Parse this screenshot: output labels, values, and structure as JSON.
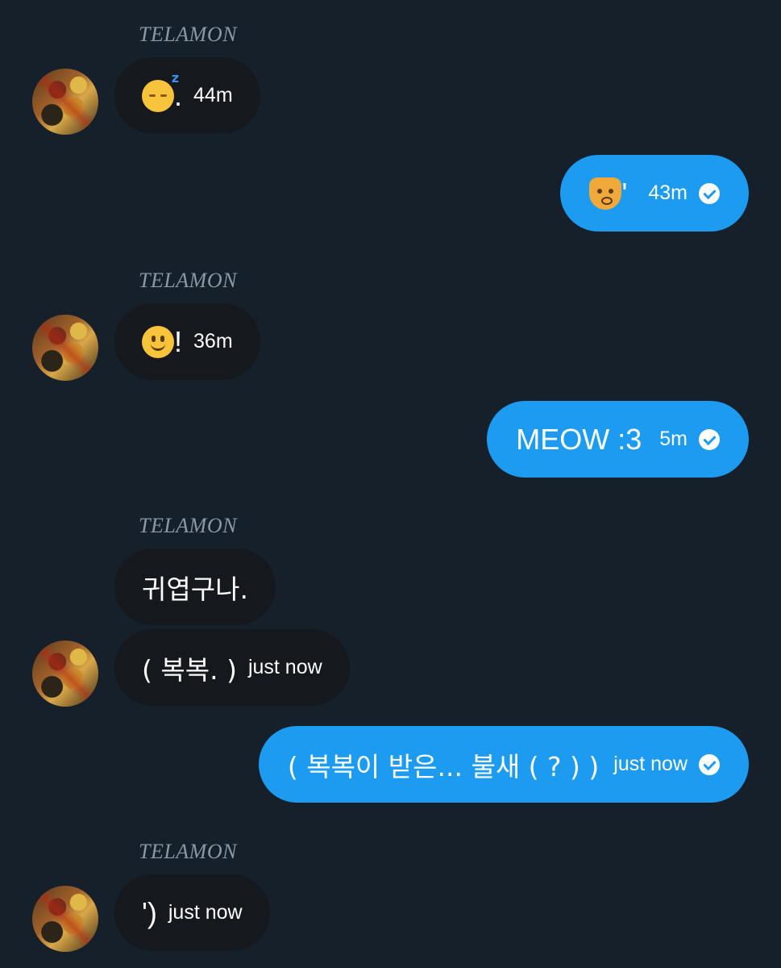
{
  "sender_name": "TELAMON",
  "messages": [
    {
      "id": "m1",
      "side": "in",
      "icon": "sleeping-face-emoji",
      "text": ".",
      "time": "44m"
    },
    {
      "id": "m2",
      "side": "out",
      "icon": "cat-face-emoji",
      "text": "'",
      "time": "43m"
    },
    {
      "id": "m3",
      "side": "in",
      "icon": "slightly-smiling-face-emoji",
      "text": "!",
      "time": "36m"
    },
    {
      "id": "m4",
      "side": "out",
      "text": "MEOW :3",
      "time": "5m"
    },
    {
      "id": "m5",
      "side": "in",
      "text": "귀엽구나."
    },
    {
      "id": "m6",
      "side": "in",
      "text": "( 복복. )",
      "time": "just now"
    },
    {
      "id": "m7",
      "side": "out",
      "text": "( 복복이 받은... 불새 ( ? ) )",
      "time": "just now"
    },
    {
      "id": "m8",
      "side": "in",
      "text": "')",
      "time": "just now"
    }
  ],
  "colors": {
    "background": "#15202b",
    "incoming_bubble": "#15181c",
    "outgoing_bubble": "#1d9bf0"
  }
}
